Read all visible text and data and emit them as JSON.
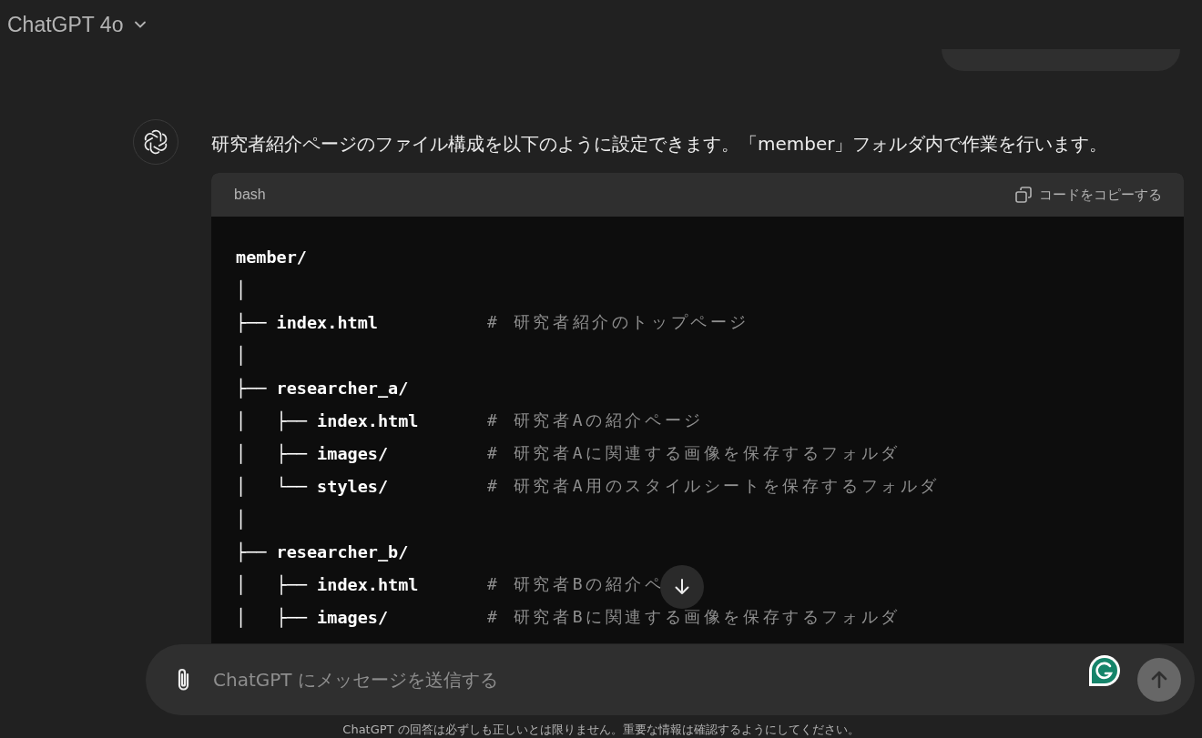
{
  "header": {
    "model": "ChatGPT 4o"
  },
  "message": {
    "text": "研究者紹介ページのファイル構成を以下のように設定できます。「member」フォルダ内で作業を行います。"
  },
  "code_block": {
    "language": "bash",
    "copy_label": "コードをコピーする",
    "lines": [
      {
        "code": "member/"
      },
      {
        "code": "│"
      },
      {
        "code": "├── index.html",
        "comment": "# 研究者紹介のトップページ"
      },
      {
        "code": "│"
      },
      {
        "code": "├── researcher_a/"
      },
      {
        "code": "│   ├── index.html",
        "comment": "# 研究者Aの紹介ページ"
      },
      {
        "code": "│   ├── images/",
        "comment": "# 研究者Aに関連する画像を保存するフォルダ"
      },
      {
        "code": "│   └── styles/",
        "comment": "# 研究者A用のスタイルシートを保存するフォルダ"
      },
      {
        "code": "│"
      },
      {
        "code": "├── researcher_b/"
      },
      {
        "code": "│   ├── index.html",
        "comment": "# 研究者Bの紹介ペ"
      },
      {
        "code": "│   ├── images/",
        "comment": "# 研究者Bに関連する画像を保存するフォルダ"
      }
    ]
  },
  "composer": {
    "placeholder": "ChatGPT にメッセージを送信する"
  },
  "disclaimer": "ChatGPT の回答は必ずしも正しいとは限りません。重要な情報は確認するようにしてください。"
}
